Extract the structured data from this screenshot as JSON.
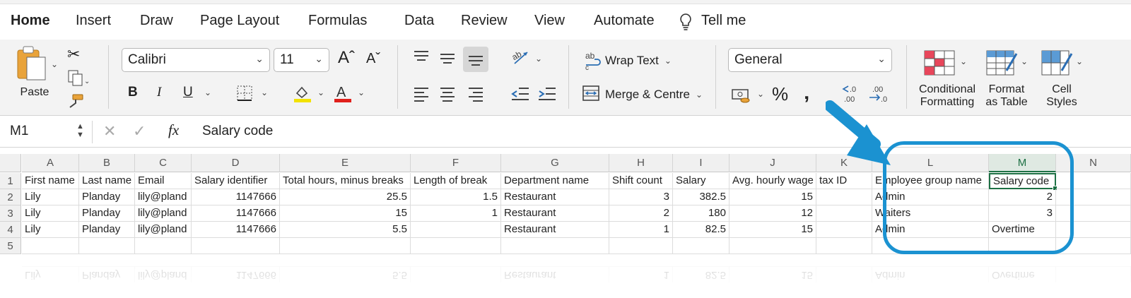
{
  "ribbon_tabs": [
    "Home",
    "Insert",
    "Draw",
    "Page Layout",
    "Formulas",
    "Data",
    "Review",
    "View",
    "Automate"
  ],
  "tell_me": "Tell me",
  "clipboard": {
    "paste_label": "Paste"
  },
  "font": {
    "name": "Calibri",
    "size": "11"
  },
  "alignment": {
    "wrap_text": "Wrap Text",
    "merge_centre": "Merge & Centre"
  },
  "number": {
    "format": "General"
  },
  "styles": {
    "conditional_line1": "Conditional",
    "conditional_line2": "Formatting",
    "format_table_line1": "Format",
    "format_table_line2": "as Table",
    "cell_styles_line1": "Cell",
    "cell_styles_line2": "Styles"
  },
  "formula_bar": {
    "name_box": "M1",
    "fx": "fx",
    "content": "Salary code"
  },
  "colors": {
    "accent": "#1e7145",
    "highlight": "#1b92d1",
    "font_underline": "#f2e200",
    "font_color": "#e0201b"
  },
  "sheet": {
    "columns": [
      "A",
      "B",
      "C",
      "D",
      "E",
      "F",
      "G",
      "H",
      "I",
      "J",
      "K",
      "L",
      "M",
      "N"
    ],
    "row_numbers": [
      "1",
      "2",
      "3",
      "4",
      "5"
    ],
    "selected_column": "M",
    "selected_cell": "M1",
    "rows": [
      [
        "First name",
        "Last name",
        "Email",
        "Salary identifier",
        "Total hours, minus breaks",
        "Length of break",
        "Department name",
        "Shift count",
        "Salary",
        "Avg. hourly wage",
        "tax ID",
        "Employee group name",
        "Salary code",
        ""
      ],
      [
        "Lily",
        "Planday",
        "lily@pland",
        "1147666",
        "25.5",
        "1.5",
        "Restaurant",
        "3",
        "382.5",
        "15",
        "",
        "Admin",
        "2",
        ""
      ],
      [
        "Lily",
        "Planday",
        "lily@pland",
        "1147666",
        "15",
        "1",
        "Restaurant",
        "2",
        "180",
        "12",
        "",
        "Waiters",
        "3",
        ""
      ],
      [
        "Lily",
        "Planday",
        "lily@pland",
        "1147666",
        "5.5",
        "",
        "Restaurant",
        "1",
        "82.5",
        "15",
        "",
        "Admin",
        "Overtime",
        ""
      ],
      [
        "",
        "",
        "",
        "",
        "",
        "",
        "",
        "",
        "",
        "",
        "",
        "",
        "",
        ""
      ]
    ],
    "reflection_row": [
      "Lily",
      "Planday",
      "lily@pland",
      "1147666",
      "5.5",
      "",
      "Restaurant",
      "1",
      "82.5",
      "15",
      "",
      "Admin",
      "Overtime",
      ""
    ]
  }
}
